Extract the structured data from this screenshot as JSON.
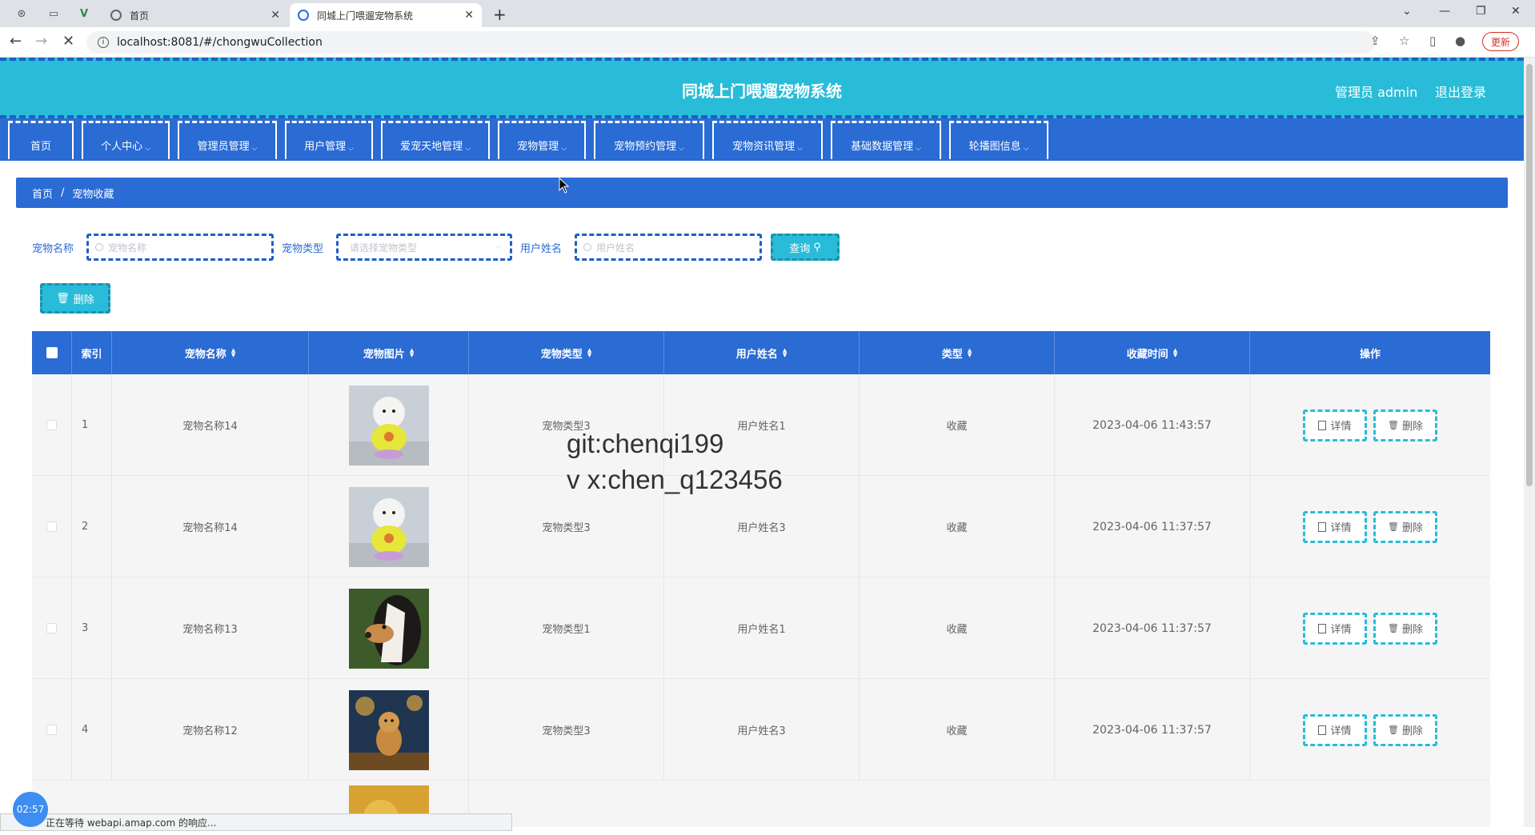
{
  "browser": {
    "tabs": [
      {
        "title": "首页",
        "active": false
      },
      {
        "title": "同城上门喂遛宠物系统",
        "active": true
      }
    ],
    "url": "localhost:8081/#/chongwuCollection",
    "update_label": "更新",
    "status_text": "正在等待 webapi.amap.com 的响应...",
    "timer": "02:57"
  },
  "header": {
    "title": "同城上门喂遛宠物系统",
    "user": "管理员 admin",
    "logout": "退出登录"
  },
  "menu": [
    {
      "label": "首页",
      "dropdown": false
    },
    {
      "label": "个人中心",
      "dropdown": true
    },
    {
      "label": "管理员管理",
      "dropdown": true
    },
    {
      "label": "用户管理",
      "dropdown": true
    },
    {
      "label": "爱宠天地管理",
      "dropdown": true
    },
    {
      "label": "宠物管理",
      "dropdown": true
    },
    {
      "label": "宠物预约管理",
      "dropdown": true
    },
    {
      "label": "宠物资讯管理",
      "dropdown": true
    },
    {
      "label": "基础数据管理",
      "dropdown": true
    },
    {
      "label": "轮播图信息",
      "dropdown": true
    }
  ],
  "breadcrumb": {
    "home": "首页",
    "separator": "/",
    "current": "宠物收藏"
  },
  "search": {
    "pet_name_label": "宠物名称",
    "pet_name_placeholder": "宠物名称",
    "pet_type_label": "宠物类型",
    "pet_type_placeholder": "请选择宠物类型",
    "user_name_label": "用户姓名",
    "user_name_placeholder": "用户姓名",
    "query_label": "查询"
  },
  "actions": {
    "delete_label": "删除"
  },
  "table": {
    "columns": [
      "索引",
      "宠物名称",
      "宠物图片",
      "宠物类型",
      "用户姓名",
      "类型",
      "收藏时间",
      "操作"
    ],
    "rows": [
      {
        "index": "1",
        "pet_name": "宠物名称14",
        "pet_type": "宠物类型3",
        "user_name": "用户姓名1",
        "type": "收藏",
        "time": "2023-04-06 11:43:57",
        "image": "white-poodle"
      },
      {
        "index": "2",
        "pet_name": "宠物名称14",
        "pet_type": "宠物类型3",
        "user_name": "用户姓名3",
        "type": "收藏",
        "time": "2023-04-06 11:37:57",
        "image": "white-poodle"
      },
      {
        "index": "3",
        "pet_name": "宠物名称13",
        "pet_type": "宠物类型1",
        "user_name": "用户姓名1",
        "type": "收藏",
        "time": "2023-04-06 11:37:57",
        "image": "collie"
      },
      {
        "index": "4",
        "pet_name": "宠物名称12",
        "pet_type": "宠物类型3",
        "user_name": "用户姓名3",
        "type": "收藏",
        "time": "2023-04-06 11:37:57",
        "image": "golden-dog"
      }
    ],
    "detail_label": "详情",
    "delete_label": "删除"
  },
  "watermark": [
    "git:chenqi199",
    "v x:chen_q123456"
  ]
}
